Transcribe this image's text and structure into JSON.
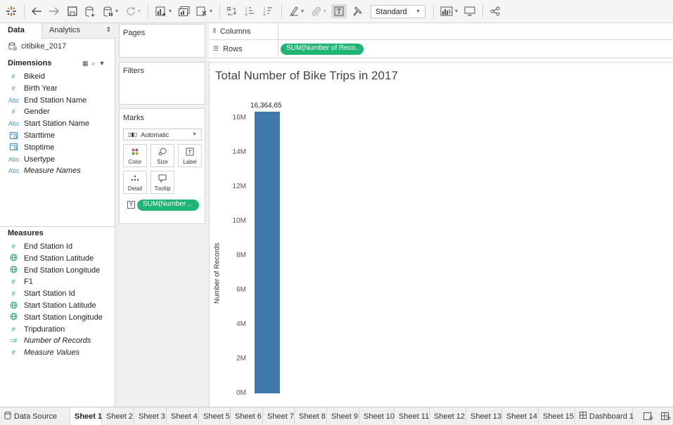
{
  "toolbar": {
    "icons": [
      "tableau-logo-icon",
      "undo-icon",
      "redo-icon",
      "save-icon",
      "new-datasource-icon",
      "pause-updates-icon",
      "refresh-icon",
      "new-worksheet-icon",
      "duplicate-icon",
      "clear-icon",
      "swap-icon",
      "sort-ascending-icon",
      "sort-descending-icon",
      "highlight-icon",
      "paperclip-icon",
      "label-icon",
      "pin-icon",
      "show-me-icon",
      "presentation-icon",
      "share-icon"
    ],
    "fit_select": "Standard"
  },
  "data_pane": {
    "tab_data": "Data",
    "tab_analytics": "Analytics",
    "datasource": "citibike_2017",
    "dimensions_heading": "Dimensions",
    "dimensions": [
      {
        "label": "Bikeid",
        "type": "#"
      },
      {
        "label": "Birth Year",
        "type": "#"
      },
      {
        "label": "End Station Name",
        "type": "Abc"
      },
      {
        "label": "Gender",
        "type": "#"
      },
      {
        "label": "Start Station Name",
        "type": "Abc"
      },
      {
        "label": "Starttime",
        "type": "date"
      },
      {
        "label": "Stoptime",
        "type": "date"
      },
      {
        "label": "Usertype",
        "type": "Abc"
      },
      {
        "label": "Measure Names",
        "type": "Abc"
      }
    ],
    "measures_heading": "Measures",
    "measures": [
      {
        "label": "End Station Id",
        "type": "#"
      },
      {
        "label": "End Station Latitude",
        "type": "geo"
      },
      {
        "label": "End Station Longitude",
        "type": "geo"
      },
      {
        "label": "F1",
        "type": "#"
      },
      {
        "label": "Start Station Id",
        "type": "#"
      },
      {
        "label": "Start Station Latitude",
        "type": "geo"
      },
      {
        "label": "Start Station Longitude",
        "type": "geo"
      },
      {
        "label": "Tripduration",
        "type": "#"
      },
      {
        "label": "Number of Records",
        "type": "=#"
      },
      {
        "label": "Measure Values",
        "type": "#"
      }
    ]
  },
  "cards": {
    "pages": "Pages",
    "filters": "Filters",
    "marks": "Marks",
    "mark_type": "Automatic",
    "buttons": [
      "Color",
      "Size",
      "Label",
      "Detail",
      "Tooltip"
    ],
    "mark_pill": "SUM(Number .."
  },
  "shelves": {
    "columns": "Columns",
    "rows": "Rows",
    "rows_pill": "SUM(Number of Reco.."
  },
  "chart_data": {
    "type": "bar",
    "title": "Total Number of Bike Trips in 2017",
    "ylabel": "Number of Records",
    "xlabel": "",
    "categories": [
      ""
    ],
    "values": [
      16364657
    ],
    "data_label": "16,364,65",
    "yticks": [
      "0M",
      "2M",
      "4M",
      "6M",
      "8M",
      "10M",
      "12M",
      "14M",
      "16M"
    ],
    "ylim": [
      0,
      16364657
    ],
    "color": "#3e78ad"
  },
  "bottom_tabs": [
    "Data Source",
    "Sheet 1",
    "Sheet 2",
    "Sheet 3",
    "Sheet 4",
    "Sheet 5",
    "Sheet 6",
    "Sheet 7",
    "Sheet 8",
    "Sheet 9",
    "Sheet 10",
    "Sheet 11",
    "Sheet 12",
    "Sheet 13",
    "Sheet 14",
    "Sheet 15",
    "Dashboard 1"
  ],
  "active_tab": "Sheet 1",
  "colors": {
    "accent_green": "#1fb577",
    "bar_blue": "#3e78ad"
  }
}
